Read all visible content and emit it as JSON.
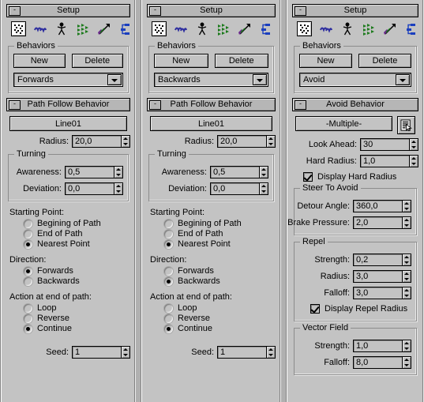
{
  "theme": {
    "face": "#c3c3c3",
    "desktop": "#b0b0b0",
    "header": "#b6b6b6",
    "text": "#000000"
  },
  "icons": [
    {
      "name": "crowd-icon",
      "title": "Crowd"
    },
    {
      "name": "bird-wave-icon",
      "title": "Wander"
    },
    {
      "name": "biped-figure-icon",
      "title": "Biped"
    },
    {
      "name": "flock-arrows-icon",
      "title": "Flock"
    },
    {
      "name": "vector-arrow-icon",
      "title": "Vector Field"
    },
    {
      "name": "node-graph-icon",
      "title": "Scatter"
    }
  ],
  "panels": [
    {
      "id": "panel-forwards",
      "setup": {
        "title": "Setup",
        "minimize": "-",
        "behaviors_group": "Behaviors",
        "new_label": "New",
        "delete_label": "Delete",
        "dropdown_value": "Forwards"
      },
      "behavior": {
        "title": "Path Follow Behavior",
        "minimize": "-",
        "path_name": "Line01",
        "radius_label": "Radius:",
        "radius_value": "20,0",
        "turning_group": "Turning",
        "awareness_label": "Awareness:",
        "awareness_value": "0,5",
        "deviation_label": "Deviation:",
        "deviation_value": "0,0",
        "starting_point_label": "Starting Point:",
        "starting_point_options": [
          "Begining of Path",
          "End of Path",
          "Nearest Point"
        ],
        "starting_point_selected": 2,
        "direction_label": "Direction:",
        "direction_options": [
          "Forwards",
          "Backwards"
        ],
        "direction_selected": 0,
        "action_label": "Action at end of path:",
        "action_options": [
          "Loop",
          "Reverse",
          "Continue"
        ],
        "action_selected": 2,
        "seed_label": "Seed:",
        "seed_value": "1"
      }
    },
    {
      "id": "panel-backwards",
      "setup": {
        "title": "Setup",
        "minimize": "-",
        "behaviors_group": "Behaviors",
        "new_label": "New",
        "delete_label": "Delete",
        "dropdown_value": "Backwards"
      },
      "behavior": {
        "title": "Path Follow Behavior",
        "minimize": "-",
        "path_name": "Line01",
        "radius_label": "Radius:",
        "radius_value": "20,0",
        "turning_group": "Turning",
        "awareness_label": "Awareness:",
        "awareness_value": "0,5",
        "deviation_label": "Deviation:",
        "deviation_value": "0,0",
        "starting_point_label": "Starting Point:",
        "starting_point_options": [
          "Begining of Path",
          "End of Path",
          "Nearest Point"
        ],
        "starting_point_selected": 2,
        "direction_label": "Direction:",
        "direction_options": [
          "Forwards",
          "Backwards"
        ],
        "direction_selected": 1,
        "action_label": "Action at end of path:",
        "action_options": [
          "Loop",
          "Reverse",
          "Continue"
        ],
        "action_selected": 2,
        "seed_label": "Seed:",
        "seed_value": "1"
      }
    },
    {
      "id": "panel-avoid",
      "setup": {
        "title": "Setup",
        "minimize": "-",
        "behaviors_group": "Behaviors",
        "new_label": "New",
        "delete_label": "Delete",
        "dropdown_value": "Avoid"
      },
      "avoid": {
        "title": "Avoid Behavior",
        "minimize": "-",
        "target_name": "-Multiple-",
        "picker_icon": "select-by-list-icon",
        "look_ahead_label": "Look Ahead:",
        "look_ahead_value": "30",
        "hard_radius_label": "Hard Radius:",
        "hard_radius_value": "1,0",
        "display_hard_radius_label": "Display Hard Radius",
        "display_hard_radius_checked": true,
        "steer_group": "Steer To Avoid",
        "detour_angle_label": "Detour Angle:",
        "detour_angle_value": "360,0",
        "brake_pressure_label": "Brake Pressure:",
        "brake_pressure_value": "2,0",
        "repel_group": "Repel",
        "repel_strength_label": "Strength:",
        "repel_strength_value": "0,2",
        "repel_radius_label": "Radius:",
        "repel_radius_value": "3,0",
        "repel_falloff_label": "Falloff:",
        "repel_falloff_value": "3,0",
        "display_repel_radius_label": "Display Repel Radius",
        "display_repel_radius_checked": true,
        "vector_group": "Vector Field",
        "vector_strength_label": "Strength:",
        "vector_strength_value": "1,0",
        "vector_falloff_label": "Falloff:",
        "vector_falloff_value": "8,0"
      }
    }
  ]
}
